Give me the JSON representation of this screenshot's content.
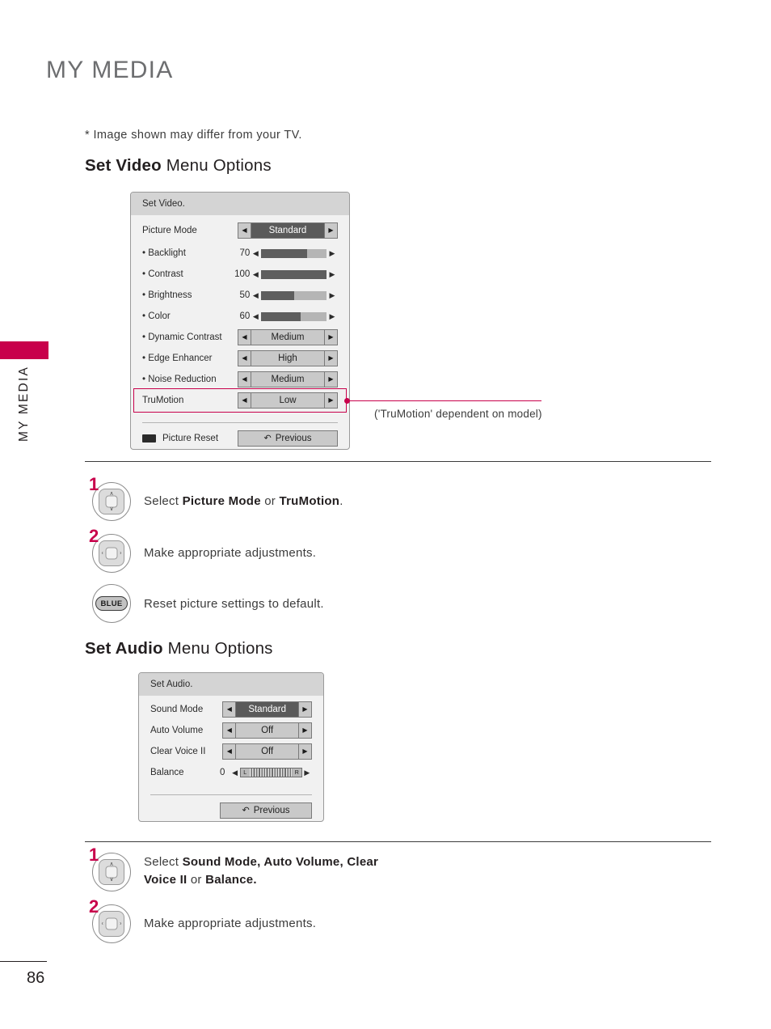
{
  "rail": {
    "label": "MY MEDIA",
    "page_number": "86",
    "accent_color": "#c8004b"
  },
  "page": {
    "title": "MY MEDIA",
    "note": "* Image shown may differ from your TV."
  },
  "video_section": {
    "heading_bold": "Set Video",
    "heading_rest": " Menu Options",
    "panel": {
      "header": "Set Video.",
      "rows": [
        {
          "label": "Picture Mode",
          "type": "stepper",
          "value": "Standard",
          "selected": true
        },
        {
          "label": "• Backlight",
          "type": "slider",
          "value": "70",
          "fill": 70
        },
        {
          "label": "• Contrast",
          "type": "slider",
          "value": "100",
          "fill": 100
        },
        {
          "label": "• Brightness",
          "type": "slider",
          "value": "50",
          "fill": 50
        },
        {
          "label": "• Color",
          "type": "slider",
          "value": "60",
          "fill": 60
        },
        {
          "label": "• Dynamic Contrast",
          "type": "stepper",
          "value": "Medium",
          "selected": false
        },
        {
          "label": "• Edge Enhancer",
          "type": "stepper",
          "value": "High",
          "selected": false
        },
        {
          "label": "• Noise Reduction",
          "type": "stepper",
          "value": "Medium",
          "selected": false
        },
        {
          "label": "TruMotion",
          "type": "stepper",
          "value": "Low",
          "selected": false
        }
      ],
      "footer": {
        "reset_label": "Picture Reset",
        "previous_label": "Previous",
        "previous_glyph": "↶"
      }
    },
    "callout": "('TruMotion' dependent on model)",
    "steps": [
      {
        "num": "1",
        "icon": "nav-updown-icon",
        "text_parts": [
          {
            "t": "Select ",
            "b": false
          },
          {
            "t": "Picture Mode",
            "b": true
          },
          {
            "t": " or ",
            "b": false
          },
          {
            "t": "TruMotion",
            "b": true
          },
          {
            "t": ".",
            "b": false
          }
        ]
      },
      {
        "num": "2",
        "icon": "nav-leftright-icon",
        "text_parts": [
          {
            "t": "Make appropriate adjustments.",
            "b": false
          }
        ]
      },
      {
        "num": "",
        "icon": "blue-button-icon",
        "button_label": "BLUE",
        "text_parts": [
          {
            "t": "Reset picture settings to default.",
            "b": false
          }
        ]
      }
    ]
  },
  "audio_section": {
    "heading_bold": "Set Audio",
    "heading_rest": " Menu Options",
    "panel": {
      "header": "Set Audio.",
      "rows": [
        {
          "label": "Sound Mode",
          "type": "stepper",
          "value": "Standard",
          "selected": true
        },
        {
          "label": "Auto Volume",
          "type": "stepper",
          "value": "Off",
          "selected": false
        },
        {
          "label": "Clear Voice II",
          "type": "stepper",
          "value": "Off",
          "selected": false
        },
        {
          "label": "Balance",
          "type": "balance",
          "value": "0",
          "left_cap": "L",
          "right_cap": "R"
        }
      ],
      "footer": {
        "previous_label": "Previous",
        "previous_glyph": "↶"
      }
    },
    "steps": [
      {
        "num": "1",
        "icon": "nav-updown-icon",
        "text_parts": [
          {
            "t": "Select ",
            "b": false
          },
          {
            "t": "Sound Mode, Auto Volume, Clear Voice II",
            "b": true
          },
          {
            "t": " or ",
            "b": false
          },
          {
            "t": "Balance.",
            "b": true
          }
        ]
      },
      {
        "num": "2",
        "icon": "nav-leftright-icon",
        "text_parts": [
          {
            "t": "Make appropriate adjustments.",
            "b": false
          }
        ]
      }
    ]
  },
  "glyphs": {
    "arrow_left": "◀",
    "arrow_right": "▶",
    "chevron_up": "∧",
    "chevron_down": "∨",
    "chevron_left": "‹",
    "chevron_right": "›"
  }
}
